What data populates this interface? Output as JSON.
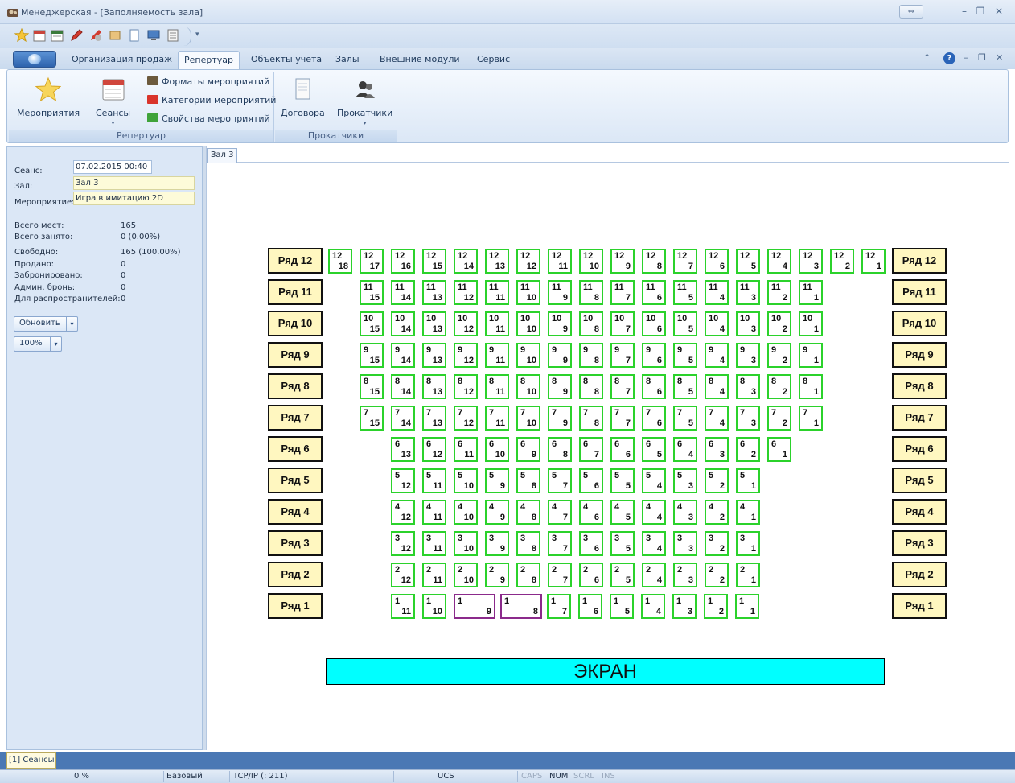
{
  "window": {
    "title": "Менеджерская - [Заполняемость зала]",
    "mini_toggle": "⇔"
  },
  "ribbon_tabs": [
    "Организация продаж",
    "Репертуар",
    "Объекты учета",
    "Залы",
    "Внешние модули",
    "Сервис"
  ],
  "ribbon": {
    "group_repertoire": {
      "label": "Репертуар",
      "events": "Мероприятия",
      "sessions": "Сеансы",
      "formats": "Форматы мероприятий",
      "categories": "Категории мероприятий",
      "properties": "Свойства мероприятий"
    },
    "group_distributors": {
      "label": "Прокатчики",
      "contracts": "Договора",
      "distributors": "Прокатчики"
    }
  },
  "session": {
    "label": "Сеанс:",
    "value": "07.02.2015 00:40",
    "hall_label": "Зал:",
    "hall_value": "Зал 3",
    "event_label": "Мероприятие:",
    "event_value": "Игра в имитацию 2D"
  },
  "stats": [
    {
      "label": "Всего мест:",
      "value": "165"
    },
    {
      "label": "Всего занято:",
      "value": "0 (0.00%)"
    },
    {
      "label": "Свободно:",
      "value": "165 (100.00%)"
    },
    {
      "label": "Продано:",
      "value": "0"
    },
    {
      "label": "Забронировано:",
      "value": "0"
    },
    {
      "label": "Админ. бронь:",
      "value": "0"
    },
    {
      "label": "Для распространителей:",
      "value": "0"
    }
  ],
  "refresh_label": "Обновить",
  "zoom_value": "100%",
  "doc_tab": "Зал 3",
  "row_prefix": "Ряд",
  "rows": [
    {
      "row": 12,
      "seats": 18,
      "start": 408
    },
    {
      "row": 11,
      "seats": 15,
      "start": 447
    },
    {
      "row": 10,
      "seats": 15,
      "start": 447
    },
    {
      "row": 9,
      "seats": 15,
      "start": 447
    },
    {
      "row": 8,
      "seats": 15,
      "start": 447
    },
    {
      "row": 7,
      "seats": 15,
      "start": 447
    },
    {
      "row": 6,
      "seats": 13,
      "start": 486
    },
    {
      "row": 5,
      "seats": 12,
      "start": 486
    },
    {
      "row": 4,
      "seats": 12,
      "start": 486
    },
    {
      "row": 3,
      "seats": 12,
      "start": 486
    },
    {
      "row": 2,
      "seats": 12,
      "start": 486
    },
    {
      "row": 1,
      "seats": 11,
      "start": 486,
      "reserved": [
        9,
        8
      ]
    }
  ],
  "screen_label": "ЭКРАН",
  "bottom_tab": "[1] Сеансы",
  "statusbar": {
    "progress": "0 %",
    "mode": "Базовый",
    "connection": "TCP/IP (: 211)",
    "encoding": "UCS",
    "caps": "CAPS",
    "num": "NUM",
    "scrl": "SCRL",
    "ins": "INS"
  },
  "colors": {
    "seat_free": "#2bd22b",
    "seat_reserved": "#8b2a8b",
    "row_label_bg": "#fff7c0",
    "screen_bg": "#00ffff"
  }
}
